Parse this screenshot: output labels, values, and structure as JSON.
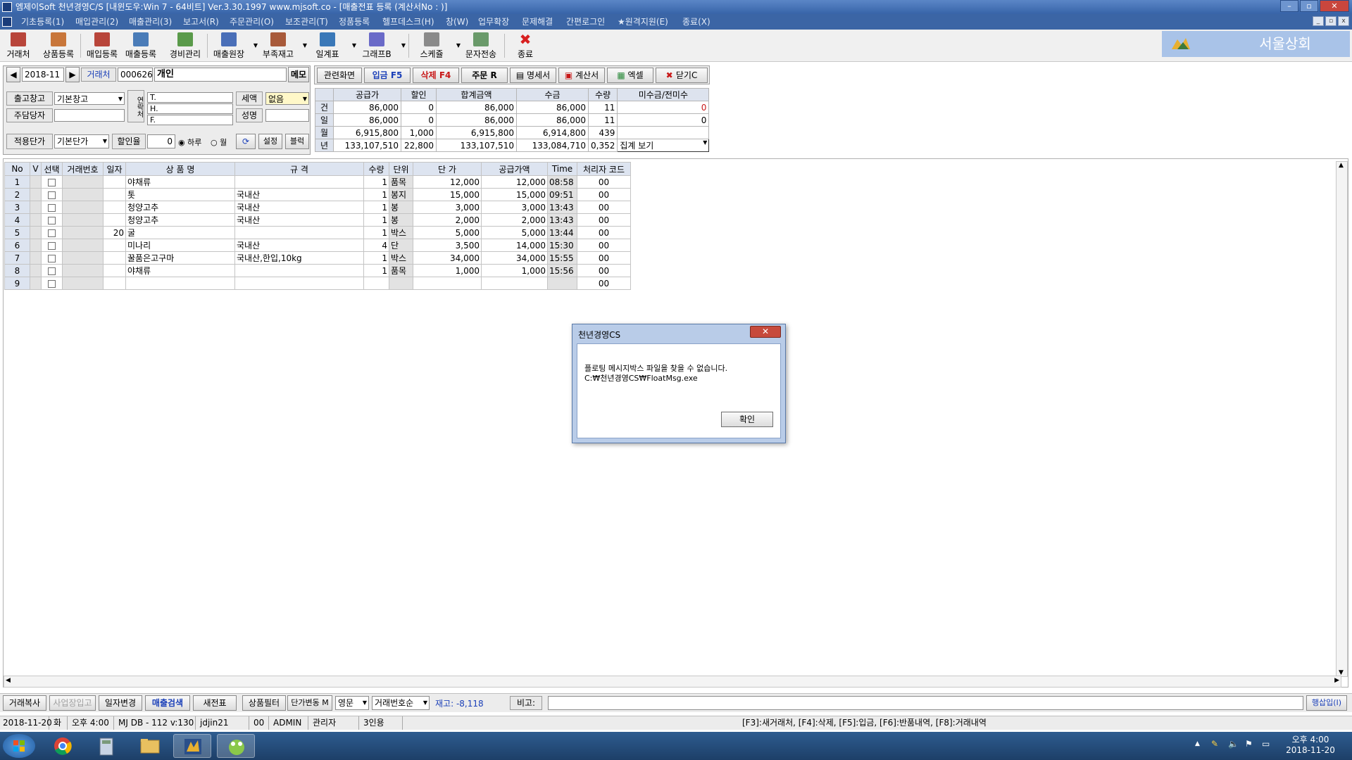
{
  "window": {
    "title": "엠제이Soft 천년경영C/S [내윈도우:Win 7 - 64비트] Ver.3.30.1997            www.mjsoft.co - [매출전표 등록 (계산서No : )]",
    "buttons": [
      "–",
      "▫",
      "✕"
    ]
  },
  "menu": [
    "기초등록(1)",
    "매입관리(2)",
    "매출관리(3)",
    "보고서(R)",
    "주문관리(O)",
    "보조관리(T)",
    "정품등록",
    "헬프데스크(H)",
    "창(W)",
    "업무확장",
    "문제해결",
    "간편로그인",
    "★원격지원(E)",
    "종료(X)"
  ],
  "toolbar": [
    {
      "label": "거래처",
      "icon": "client-icon",
      "color": "#b8453a"
    },
    {
      "label": "상품등록",
      "icon": "product-icon",
      "color": "#c8763a"
    },
    {
      "label": "매입등록",
      "icon": "purchase-icon",
      "color": "#b8453a"
    },
    {
      "label": "매출등록",
      "icon": "sales-icon",
      "color": "#4a7cb8"
    },
    {
      "label": "경비관리",
      "icon": "expense-icon",
      "color": "#5a9a4a"
    },
    {
      "label": "매출원장",
      "icon": "ledger-icon",
      "color": "#4a6fb8"
    },
    {
      "label": "부족재고",
      "icon": "stock-icon",
      "color": "#a85a3a"
    },
    {
      "label": "일계표",
      "icon": "daily-icon",
      "color": "#3a78b8"
    },
    {
      "label": "그래프B",
      "icon": "graph-icon",
      "color": "#6a6ac8"
    },
    {
      "label": "스케쥴",
      "icon": "schedule-icon",
      "color": "#8a8a8a"
    },
    {
      "label": "문자전송",
      "icon": "sms-icon",
      "color": "#6a9a6a"
    },
    {
      "label": "종료",
      "icon": "exit-icon",
      "color": "#d82020"
    }
  ],
  "logo": {
    "text": "서울상회"
  },
  "header": {
    "prev": "◀",
    "period": "2018-11",
    "next": "▶",
    "client_label": "거래처",
    "client_code": "000626",
    "client_name": "개인",
    "memo": "메모",
    "warehouse_label": "출고창고",
    "warehouse": "기본창고",
    "rep_label": "주담당자",
    "rep": "",
    "phone_tag": "연락처",
    "tel": "T.",
    "hp": "H.",
    "fax": "F.",
    "tax_label": "세액",
    "tax": "없음",
    "name_label": "성명",
    "name": "",
    "price_label": "적용단가",
    "price": "기본단가",
    "discount_label": "할인율",
    "discount": "0",
    "radio_day": "하루",
    "radio_month": "월",
    "settings": "설정",
    "block": "블럭"
  },
  "actions": [
    {
      "label": "관련화면",
      "color": "#000000"
    },
    {
      "label": "입금 F5",
      "color": "#1a3fb8"
    },
    {
      "label": "삭제 F4",
      "color": "#c81818"
    },
    {
      "label": "주문 R",
      "color": "#000000"
    },
    {
      "label": "명세서",
      "color": "#000000"
    },
    {
      "label": "계산서",
      "color": "#000000"
    },
    {
      "label": "엑셀",
      "color": "#000000"
    },
    {
      "label": "닫기C",
      "color": "#000000"
    }
  ],
  "stats": {
    "headers": [
      "",
      "공급가",
      "할인",
      "합계금액",
      "수금",
      "수량",
      "미수금/전미수"
    ],
    "rows": [
      [
        "건",
        "86,000",
        "0",
        "86,000",
        "86,000",
        "11",
        "0"
      ],
      [
        "일",
        "86,000",
        "0",
        "86,000",
        "86,000",
        "11",
        "0"
      ],
      [
        "월",
        "6,915,800",
        "1,000",
        "6,915,800",
        "6,914,800",
        "439",
        ""
      ],
      [
        "년",
        "133,107,510",
        "22,800",
        "133,107,510",
        "133,084,710",
        "0,352",
        "집계 보기"
      ]
    ]
  },
  "grid": {
    "headers": [
      "No",
      "V",
      "선택",
      "거래번호",
      "일자",
      "상 품 명",
      "규 격",
      "수량",
      "단위",
      "단 가",
      "공급가액",
      "Time",
      "처리자 코드"
    ],
    "date": "20",
    "rows": [
      {
        "no": "1",
        "name": "야채류",
        "spec": "",
        "qty": "1",
        "unit": "품목",
        "price": "12,000",
        "amount": "12,000",
        "time": "08:58",
        "code": "00"
      },
      {
        "no": "2",
        "name": "톳",
        "spec": "국내산",
        "qty": "1",
        "unit": "봉지",
        "price": "15,000",
        "amount": "15,000",
        "time": "09:51",
        "code": "00"
      },
      {
        "no": "3",
        "name": "청양고추",
        "spec": "국내산",
        "qty": "1",
        "unit": "봉",
        "price": "3,000",
        "amount": "3,000",
        "time": "13:43",
        "code": "00"
      },
      {
        "no": "4",
        "name": "청양고추",
        "spec": "국내산",
        "qty": "1",
        "unit": "봉",
        "price": "2,000",
        "amount": "2,000",
        "time": "13:43",
        "code": "00"
      },
      {
        "no": "5",
        "name": "굴",
        "spec": "",
        "qty": "1",
        "unit": "박스",
        "price": "5,000",
        "amount": "5,000",
        "time": "13:44",
        "code": "00"
      },
      {
        "no": "6",
        "name": "미나리",
        "spec": "국내산",
        "qty": "4",
        "unit": "단",
        "price": "3,500",
        "amount": "14,000",
        "time": "15:30",
        "code": "00"
      },
      {
        "no": "7",
        "name": "꿀품은고구마",
        "spec": "국내산,한입,10kg",
        "qty": "1",
        "unit": "박스",
        "price": "34,000",
        "amount": "34,000",
        "time": "15:55",
        "code": "00"
      },
      {
        "no": "8",
        "name": "야채류",
        "spec": "",
        "qty": "1",
        "unit": "품목",
        "price": "1,000",
        "amount": "1,000",
        "time": "15:56",
        "code": "00"
      },
      {
        "no": "9",
        "name": "",
        "spec": "",
        "qty": "",
        "unit": "",
        "price": "",
        "amount": "",
        "time": "",
        "code": "00"
      }
    ]
  },
  "dialog": {
    "title": "천년경영CS",
    "close": "✕",
    "line1": "플로팅 메시지박스 파일을 찾을 수 없습니다.",
    "line2": "C:₩천년경영CS₩FloatMsg.exe",
    "ok": "확인"
  },
  "bottom": {
    "copy": "거래복사",
    "biz": "사업장입고",
    "date_change": "일자변경",
    "sales_search": "매출검색",
    "new_slip": "새전표",
    "filter": "상품필터",
    "price_change": "단가변동 M",
    "lang": "영문",
    "sort": "거래번호순",
    "stock": "재고: -8,118",
    "note_label": "비고:",
    "note": "",
    "row_insert": "행삽입(I)"
  },
  "status": {
    "date": "2018-11-20",
    "weekday": "화",
    "time": "오후 4:00",
    "db": "MJ DB - 112 v:130",
    "user": "jdjin21",
    "code": "00",
    "admin": "ADMIN",
    "role": "관리자",
    "seats": "3인용",
    "shortcuts": "[F3]:새거래처, [F4]:삭제, [F5]:입금, [F6]:반품내역, [F8]:거래내역"
  },
  "taskbar": {
    "clock_time": "오후 4:00",
    "clock_date": "2018-11-20"
  }
}
